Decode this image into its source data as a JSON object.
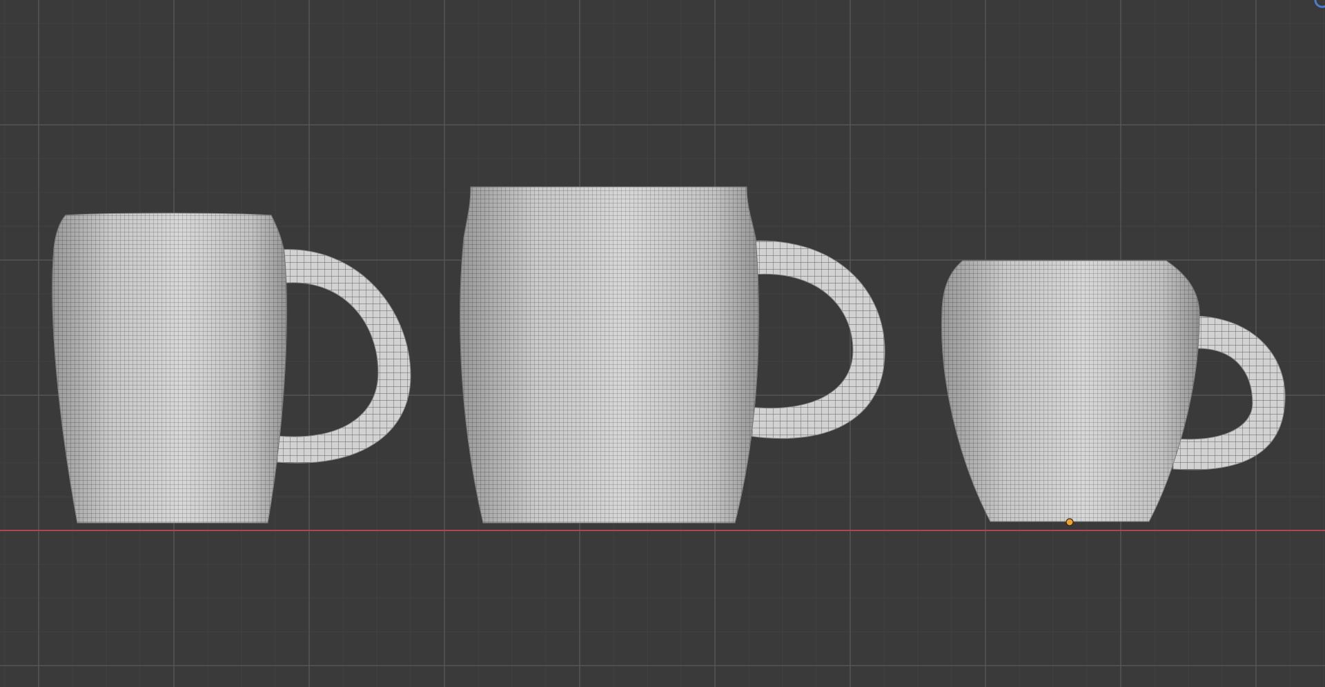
{
  "viewport": {
    "background_color": "#3a3a3a",
    "grid_major_color": "#555555",
    "grid_minor_color": "#404040",
    "x_axis_color": "#b0454f",
    "origin_color": "#f0a030",
    "mesh_color": "#d8d8d8",
    "wire_color": "#6a6a6a",
    "view_type": "orthographic-front",
    "shading": "solid-with-wireframe"
  },
  "objects": [
    {
      "name_hint": "mug-tapered",
      "icon": "mesh-icon"
    },
    {
      "name_hint": "mug-barrel",
      "icon": "mesh-icon"
    },
    {
      "name_hint": "cup-rounded",
      "icon": "mesh-icon"
    }
  ],
  "gizmo": {
    "icon": "navigation-gizmo-icon"
  }
}
